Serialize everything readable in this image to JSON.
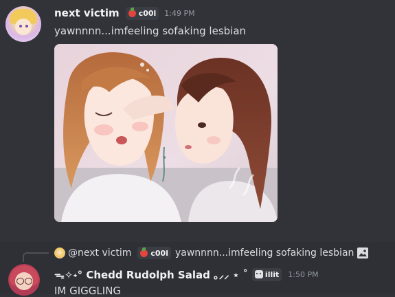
{
  "message1": {
    "username": "next victim",
    "tag": "c00l",
    "timestamp": "1:49 PM",
    "text": "yawnnnn...imfeeling sofaking lesbian"
  },
  "message2": {
    "reply": {
      "username": "@next victim",
      "tag": "c00l",
      "text": "yawnnnn...imfeeling sofaking lesbian"
    },
    "username": "ᯓ✧˖° Chedd Rudolph Salad ｡⸝⸝ ⋆ ˚",
    "tag": "illit",
    "timestamp": "1:50 PM",
    "text": "IM GIGGLING"
  },
  "colors": {
    "background": "#313338",
    "hover_background": "#2e3035",
    "username": "#f2f3f5",
    "timestamp": "#949ba4",
    "text": "#dbdee1"
  }
}
